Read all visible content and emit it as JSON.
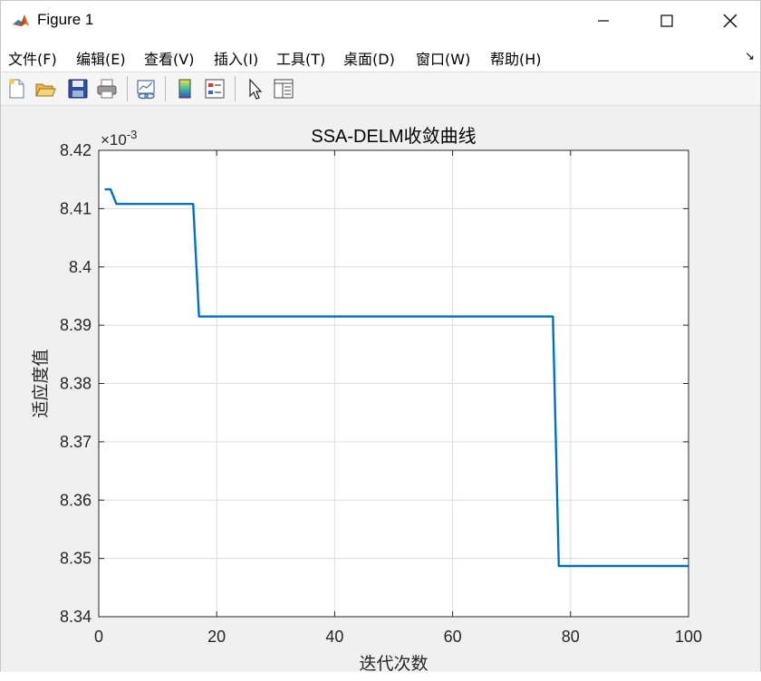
{
  "window": {
    "title": "Figure 1"
  },
  "menu": [
    {
      "label": "文件(F)"
    },
    {
      "label": "编辑(E)"
    },
    {
      "label": "查看(V)"
    },
    {
      "label": "插入(I)"
    },
    {
      "label": "工具(T)"
    },
    {
      "label": "桌面(D)"
    },
    {
      "label": "窗口(W)"
    },
    {
      "label": "帮助(H)"
    }
  ],
  "menu_overflow_icon": "corner-arrow-icon",
  "toolbar": {
    "icons": [
      "new-figure-icon",
      "open-file-icon",
      "save-icon",
      "print-icon",
      "link-plot-icon",
      "colorbar-icon",
      "legend-icon",
      "pointer-icon",
      "property-inspector-icon"
    ]
  },
  "colors": {
    "line": "#0072BD",
    "grid": "#dcdcdc",
    "axes_bg": "#ffffff",
    "figure_bg": "#f0f0f0"
  },
  "chart_data": {
    "type": "line",
    "title": "SSA-DELM收敛曲线",
    "xlabel": "迭代次数",
    "ylabel": "适应度值",
    "exponent_label": "×10",
    "exponent_power": "-3",
    "xlim": [
      0,
      100
    ],
    "ylim": [
      8.34,
      8.42
    ],
    "x_ticks": [
      0,
      20,
      40,
      60,
      80,
      100
    ],
    "x_tick_labels": [
      "0",
      "20",
      "40",
      "60",
      "80",
      "100"
    ],
    "y_ticks": [
      8.34,
      8.35,
      8.36,
      8.37,
      8.38,
      8.39,
      8.4,
      8.41,
      8.42
    ],
    "y_tick_labels": [
      "8.34",
      "8.35",
      "8.36",
      "8.37",
      "8.38",
      "8.39",
      "8.4",
      "8.41",
      "8.42"
    ],
    "grid": true,
    "series": [
      {
        "x": [
          1,
          2,
          3,
          4,
          16,
          17,
          18,
          77,
          78,
          79,
          100
        ],
        "y": [
          8.4133,
          8.4133,
          8.4108,
          8.4108,
          8.4108,
          8.3915,
          8.3915,
          8.3915,
          8.3487,
          8.3487,
          8.3487
        ]
      }
    ]
  }
}
